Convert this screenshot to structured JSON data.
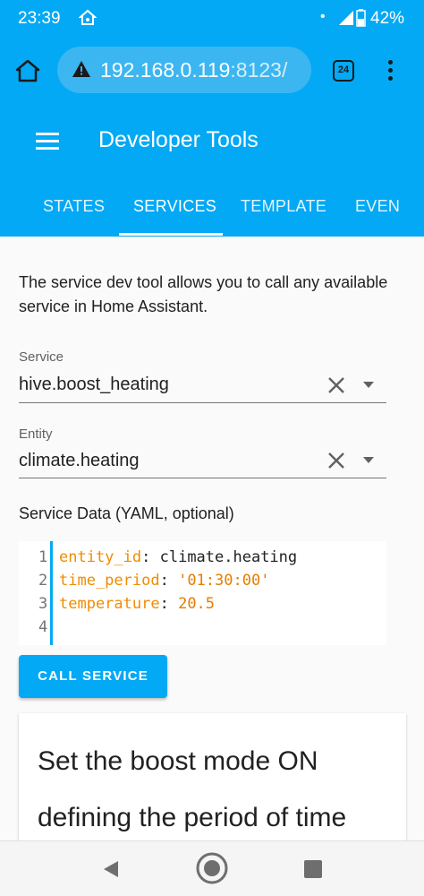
{
  "status_bar": {
    "time": "23:39",
    "dot": "•",
    "battery_percent": "42%"
  },
  "browser": {
    "url_host": "192.168.0.119",
    "url_port": ":8123/",
    "tab_count": "24"
  },
  "app": {
    "title": "Developer Tools",
    "tabs": [
      {
        "label": "STATES",
        "active": false
      },
      {
        "label": "SERVICES",
        "active": true
      },
      {
        "label": "TEMPLATE",
        "active": false
      },
      {
        "label": "EVEN",
        "active": false
      }
    ]
  },
  "services_panel": {
    "intro": "The service dev tool allows you to call any available service in Home Assistant.",
    "service_field": {
      "label": "Service",
      "value": "hive.boost_heating"
    },
    "entity_field": {
      "label": "Entity",
      "value": "climate.heating"
    },
    "yaml_label": "Service Data (YAML, optional)",
    "editor": {
      "line_numbers": [
        "1",
        "2",
        "3",
        "4"
      ],
      "lines": [
        {
          "key": "entity_id",
          "sep": ": ",
          "value": "climate.heating",
          "value_type": "plain"
        },
        {
          "key": "time_period",
          "sep": ": ",
          "value": "'01:30:00'",
          "value_type": "string"
        },
        {
          "key": "temperature",
          "sep": ": ",
          "value": "20.5",
          "value_type": "number"
        }
      ]
    },
    "call_button": "CALL SERVICE",
    "description": "Set the boost mode ON defining the period of time"
  },
  "colors": {
    "accent": "#03a9f4",
    "yaml_key": "#ef8c00"
  }
}
